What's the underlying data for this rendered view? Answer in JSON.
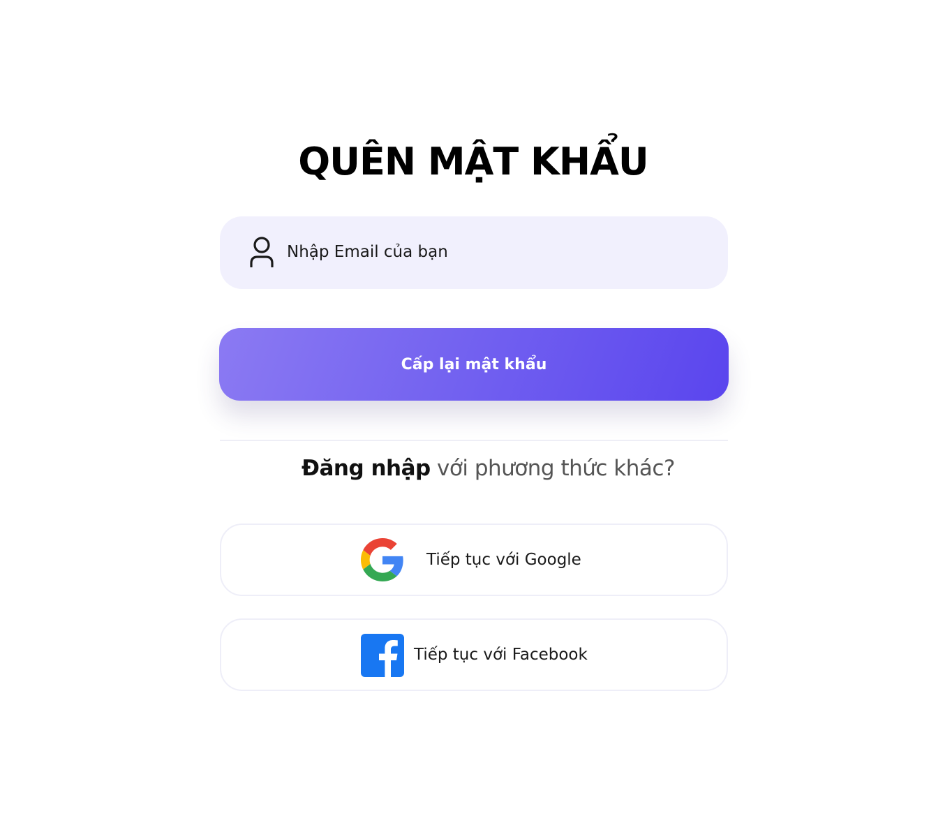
{
  "page": {
    "title": "QUÊN MẬT KHẨU"
  },
  "form": {
    "email_placeholder": "Nhập Email của bạn",
    "submit_label": "Cấp lại mật khẩu"
  },
  "alternative": {
    "login_link": "Đăng nhập",
    "prompt": " với phương thức khác?"
  },
  "social": {
    "google_label": "Tiếp tục với Google",
    "facebook_label": "Tiếp tục với Facebook"
  },
  "icons": {
    "user": "user-icon",
    "google": "google-icon",
    "facebook": "facebook-icon"
  },
  "colors": {
    "accent_start": "#8b7af3",
    "accent_end": "#5a45ee",
    "field_background": "#f1f0fd",
    "google_blue": "#4285F4",
    "google_red": "#EA4335",
    "google_yellow": "#FBBC05",
    "google_green": "#34A853",
    "facebook_blue": "#1877F2"
  }
}
